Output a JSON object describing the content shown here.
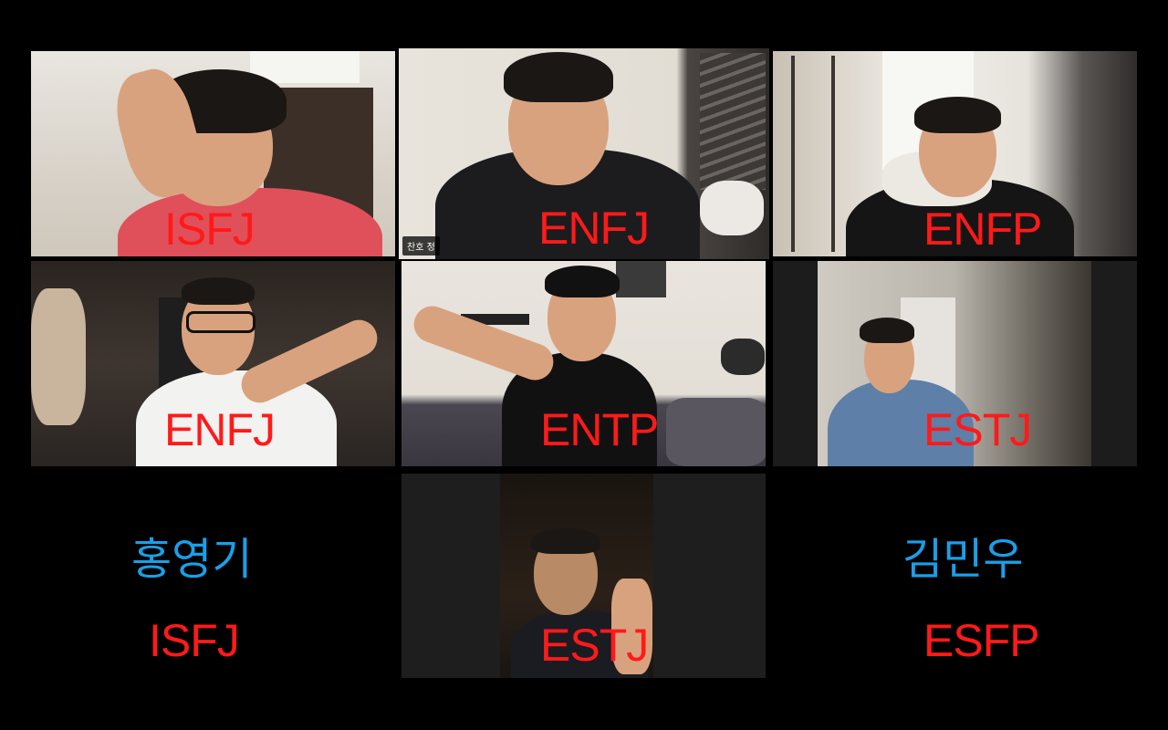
{
  "participants": [
    {
      "mbti": "ISFJ"
    },
    {
      "mbti": "ENFJ",
      "name": "찬호 정"
    },
    {
      "mbti": "ENFP"
    },
    {
      "mbti": "ENFJ"
    },
    {
      "mbti": "ENTP"
    },
    {
      "mbti": "ESTJ"
    },
    {
      "mbti": "ESTJ"
    }
  ],
  "absent": [
    {
      "name": "홍영기",
      "mbti": "ISFJ"
    },
    {
      "name": "김민우",
      "mbti": "ESFP"
    }
  ],
  "colors": {
    "mbti_label": "#ff1a1a",
    "absent_name": "#1a9fe8",
    "active_speaker_border": "#dfe36a",
    "background": "#000000"
  }
}
